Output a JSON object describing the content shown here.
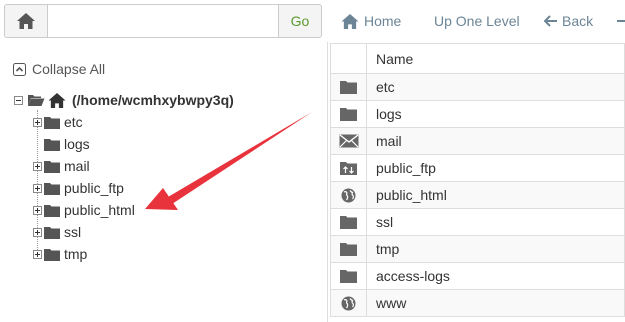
{
  "toolbar": {
    "path_value": "",
    "path_placeholder": "",
    "go_label": "Go",
    "home_label": "Home",
    "up_label": "Up One Level",
    "back_label": "Back"
  },
  "tree": {
    "collapse_label": "Collapse All",
    "root_label": "(/home/wcmhxybwpy3q)",
    "items": [
      {
        "label": "etc",
        "expandable": true
      },
      {
        "label": "logs",
        "expandable": false
      },
      {
        "label": "mail",
        "expandable": true
      },
      {
        "label": "public_ftp",
        "expandable": true
      },
      {
        "label": "public_html",
        "expandable": true
      },
      {
        "label": "ssl",
        "expandable": true
      },
      {
        "label": "tmp",
        "expandable": true
      }
    ]
  },
  "table": {
    "header_name": "Name",
    "rows": [
      {
        "name": "etc",
        "icon": "folder-icon"
      },
      {
        "name": "logs",
        "icon": "folder-icon"
      },
      {
        "name": "mail",
        "icon": "mail-icon"
      },
      {
        "name": "public_ftp",
        "icon": "ftp-folder-icon"
      },
      {
        "name": "public_html",
        "icon": "globe-icon"
      },
      {
        "name": "ssl",
        "icon": "folder-icon"
      },
      {
        "name": "tmp",
        "icon": "folder-icon"
      },
      {
        "name": "access-logs",
        "icon": "folder-icon"
      },
      {
        "name": "www",
        "icon": "globe-icon"
      }
    ]
  },
  "colors": {
    "accent_green": "#5a9a2e",
    "toolbar_text": "#6b8596",
    "folder_icon": "#666666",
    "arrow": "#e8323c"
  }
}
